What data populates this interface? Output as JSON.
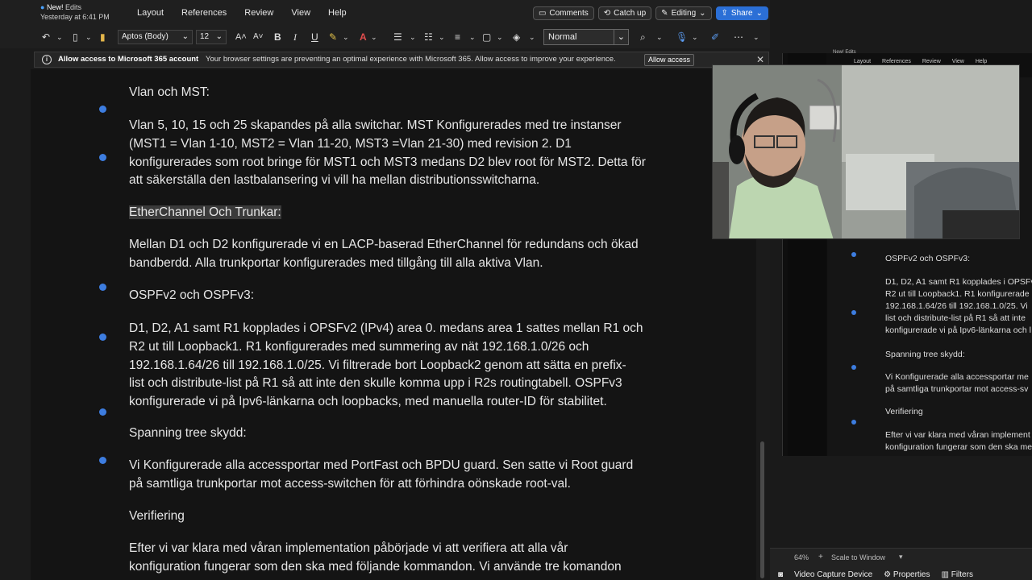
{
  "titlebar": {
    "status_new": "New!",
    "status_edits": "Edits",
    "status_time": "Yesterday at 6:41 PM",
    "menu": [
      "Layout",
      "References",
      "Review",
      "View",
      "Help"
    ],
    "comments": "Comments",
    "catchup": "Catch up",
    "editing": "Editing",
    "share": "Share"
  },
  "ribbon": {
    "font_name": "Aptos (Body)",
    "font_size": "12",
    "style": "Normal"
  },
  "notice": {
    "title": "Allow access to Microsoft 365 account",
    "message": "Your browser settings are preventing an optimal experience with Microsoft 365. Allow access to improve your experience.",
    "allow_button": "Allow access"
  },
  "document": {
    "h1": "Vlan och MST:",
    "p1": [
      "Vlan 5, 10, 15 och 25 skapandes på alla switchar. MST Konfigurerades med tre instanser",
      "(MST1 = Vlan 1-10, MST2 = Vlan 11-20, MST3 =Vlan 21-30) med revision 2.  D1",
      "konfigurerades som root bringe för MST1 och MST3 medans D2 blev root för MST2. Detta för",
      "att säkerställa den lastbalansering vi vill ha mellan distributionsswitcharna."
    ],
    "h2": "EtherChannel Och Trunkar:",
    "p2": [
      "Mellan D1 och D2 konfigurerade vi en LACP-baserad EtherChannel för redundans och ökad",
      "bandberdd. Alla trunkportar konfigurerades med tillgång till alla aktiva Vlan."
    ],
    "h3": "OSPFv2 och OSPFv3:",
    "p3": [
      "D1, D2, A1 samt R1 kopplades i OPSFv2 (IPv4) area 0. medans area 1 sattes mellan R1 och",
      "R2 ut till Loopback1. R1 konfigurerades med summering av nät 192.168.1.0/26 och",
      "192.168.1.64/26 till 192.168.1.0/25. Vi filtrerade bort Loopback2 genom att sätta en prefix-",
      "list och distribute-list på R1 så att inte den skulle komma upp i R2s routingtabell. OSPFv3",
      "konfigurerade vi på Ipv6-länkarna och loopbacks, med manuella router-ID för stabilitet."
    ],
    "h4": "Spanning tree skydd:",
    "p4": [
      "Vi Konfigurerade alla accessportar med PortFast och BPDU guard. Sen satte vi Root guard",
      "på samtliga trunkportar mot access-switchen för att förhindra oönskade root-val."
    ],
    "h5": "Verifiering",
    "p5": [
      "Efter vi var klara med våran implementation påbörjade vi att verifiera att alla vår",
      "konfiguration fungerar som den ska med följande kommandon. Vi använde tre komandon"
    ]
  },
  "preview": {
    "status_new": "New!",
    "status_edits": "Edits",
    "menu": [
      "Layout",
      "References",
      "Review",
      "View",
      "Help"
    ],
    "lines": [
      "OSPFv2 och OSPFv3:",
      "D1, D2, A1 samt R1 kopplades i OPSFv",
      "R2 ut till Loopback1. R1 konfigurerade",
      "192.168.1.64/26 till 192.168.1.0/25. Vi",
      "list och distribute-list på R1 så att inte",
      "konfigurerade vi på Ipv6-länkarna och l",
      "Spanning tree skydd:",
      "Vi Konfigurerade alla accessportar me",
      "på samtliga trunkportar mot access-sv",
      "Verifiering",
      "Efter vi var klara med våran implement",
      "konfiguration fungerar som den ska me"
    ]
  },
  "obs": {
    "zoom": "64%",
    "scale": "Scale to Window",
    "tabs": [
      "Video Capture Device",
      "Properties",
      "Filters"
    ]
  },
  "colors": {
    "accent": "#3d7de0",
    "share": "#2b6fd6",
    "text": "#e6e6e6",
    "page_bg": "#141414"
  }
}
